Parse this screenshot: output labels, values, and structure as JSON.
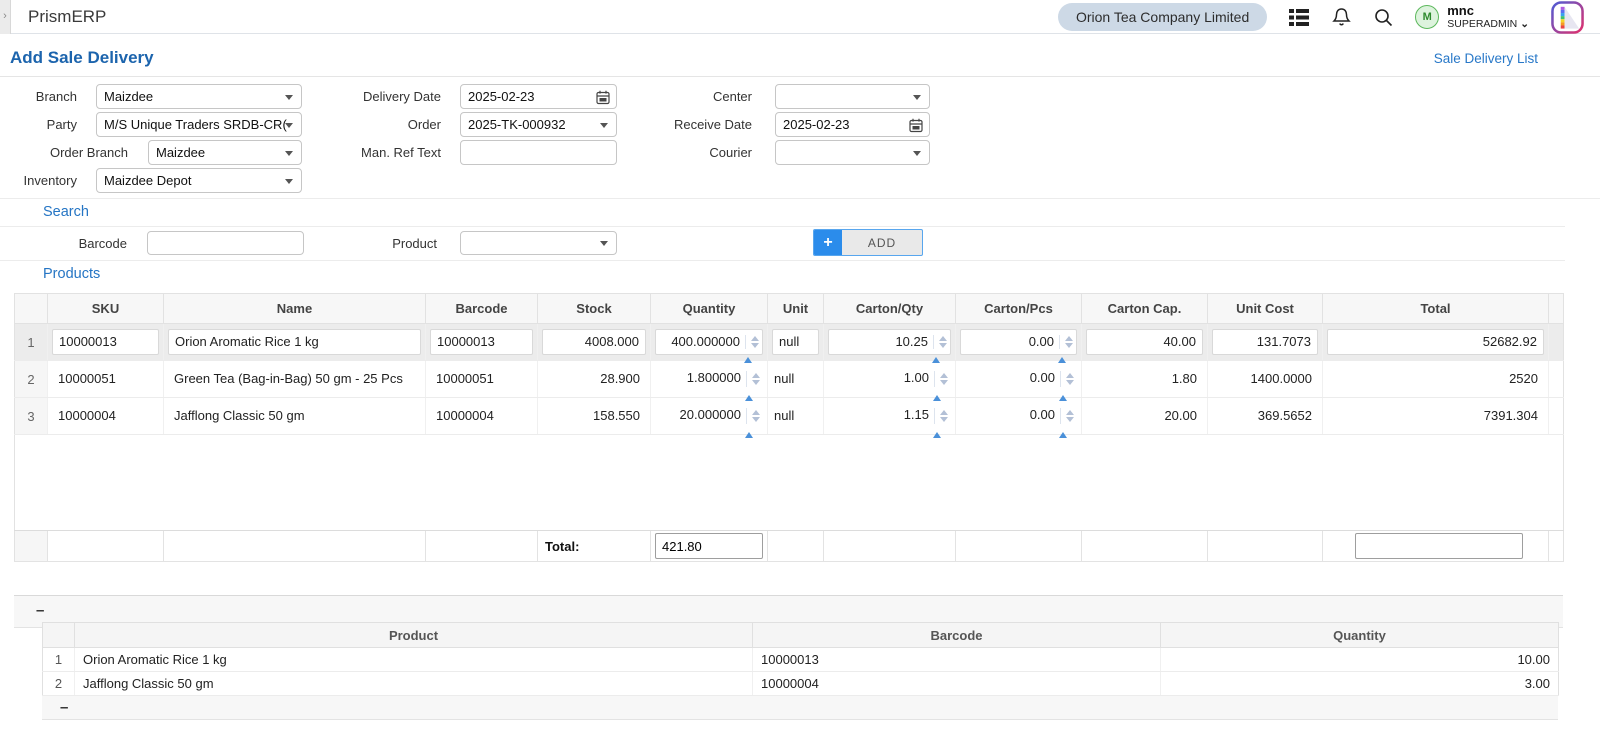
{
  "header": {
    "app_name": "PrismERP",
    "company_button": "Orion Tea Company Limited",
    "user": {
      "avatar_initial": "M",
      "name": "mnc",
      "role": "SUPERADMIN",
      "caret": "⌄"
    },
    "sidebar_toggle": "›",
    "icons": [
      "list-icon",
      "bell-icon",
      "search-icon",
      "prism-logo"
    ]
  },
  "page": {
    "title": "Add Sale Delivery",
    "top_link": "Sale Delivery List"
  },
  "form": {
    "branch": {
      "label": "Branch",
      "value": "Maizdee"
    },
    "party": {
      "label": "Party",
      "value": "M/S Unique Traders SRDB-CR("
    },
    "order_branch": {
      "label": "Order Branch",
      "value": "Maizdee"
    },
    "inventory": {
      "label": "Inventory",
      "value": "Maizdee Depot"
    },
    "delivery_date": {
      "label": "Delivery Date",
      "value": "2025-02-23"
    },
    "order": {
      "label": "Order",
      "value": "2025-TK-000932"
    },
    "man_ref_text": {
      "label": "Man. Ref Text",
      "value": ""
    },
    "center": {
      "label": "Center",
      "value": ""
    },
    "receive_date": {
      "label": "Receive Date",
      "value": "2025-02-23"
    },
    "courier": {
      "label": "Courier",
      "value": ""
    }
  },
  "search": {
    "heading": "Search",
    "barcode_label": "Barcode",
    "barcode_value": "",
    "product_label": "Product",
    "product_value": "",
    "add_label": "ADD",
    "add_plus": "+"
  },
  "products": {
    "heading": "Products",
    "columns": [
      "",
      "SKU",
      "Name",
      "Barcode",
      "Stock",
      "Quantity",
      "Unit",
      "Carton/Qty",
      "Carton/Pcs",
      "Carton Cap.",
      "Unit Cost",
      "Total"
    ],
    "rows": [
      {
        "index": "1",
        "sku": "10000013",
        "name": "Orion Aromatic Rice 1 kg",
        "barcode": "10000013",
        "stock": "4008.000",
        "quantity": "400.000000",
        "unit": "null",
        "carton_qty": "10.25",
        "carton_pcs": "0.00",
        "carton_cap": "40.00",
        "unit_cost": "131.7073",
        "total": "52682.92"
      },
      {
        "index": "2",
        "sku": "10000051",
        "name": "Green Tea (Bag-in-Bag) 50 gm - 25 Pcs",
        "barcode": "10000051",
        "stock": "28.900",
        "quantity": "1.800000",
        "unit": "null",
        "carton_qty": "1.00",
        "carton_pcs": "0.00",
        "carton_cap": "1.80",
        "unit_cost": "1400.0000",
        "total": "2520"
      },
      {
        "index": "3",
        "sku": "10000004",
        "name": "Jafflong Classic 50 gm",
        "barcode": "10000004",
        "stock": "158.550",
        "quantity": "20.000000",
        "unit": "null",
        "carton_qty": "1.15",
        "carton_pcs": "0.00",
        "carton_cap": "20.00",
        "unit_cost": "369.5652",
        "total": "7391.304"
      }
    ],
    "total_label": "Total:",
    "total_quantity": "421.80",
    "total_amount": "",
    "collapse": "–"
  },
  "summary": {
    "columns": [
      "",
      "Product",
      "Barcode",
      "Quantity"
    ],
    "rows": [
      {
        "index": "1",
        "product": "Orion Aromatic Rice 1 kg",
        "barcode": "10000013",
        "quantity": "10.00"
      },
      {
        "index": "2",
        "product": "Jafflong Classic 50 gm",
        "barcode": "10000004",
        "quantity": "3.00"
      }
    ],
    "collapse": "–"
  },
  "colors": {
    "title_blue": "#1c64ad",
    "section_blue": "#2575c4",
    "link_blue": "#2878c8",
    "add_button_blue": "#2b8ceb",
    "company_pill_bg": "#cdd9e6",
    "avatar_green": "#5cb85c",
    "selected_row_bg": "#ececec"
  }
}
